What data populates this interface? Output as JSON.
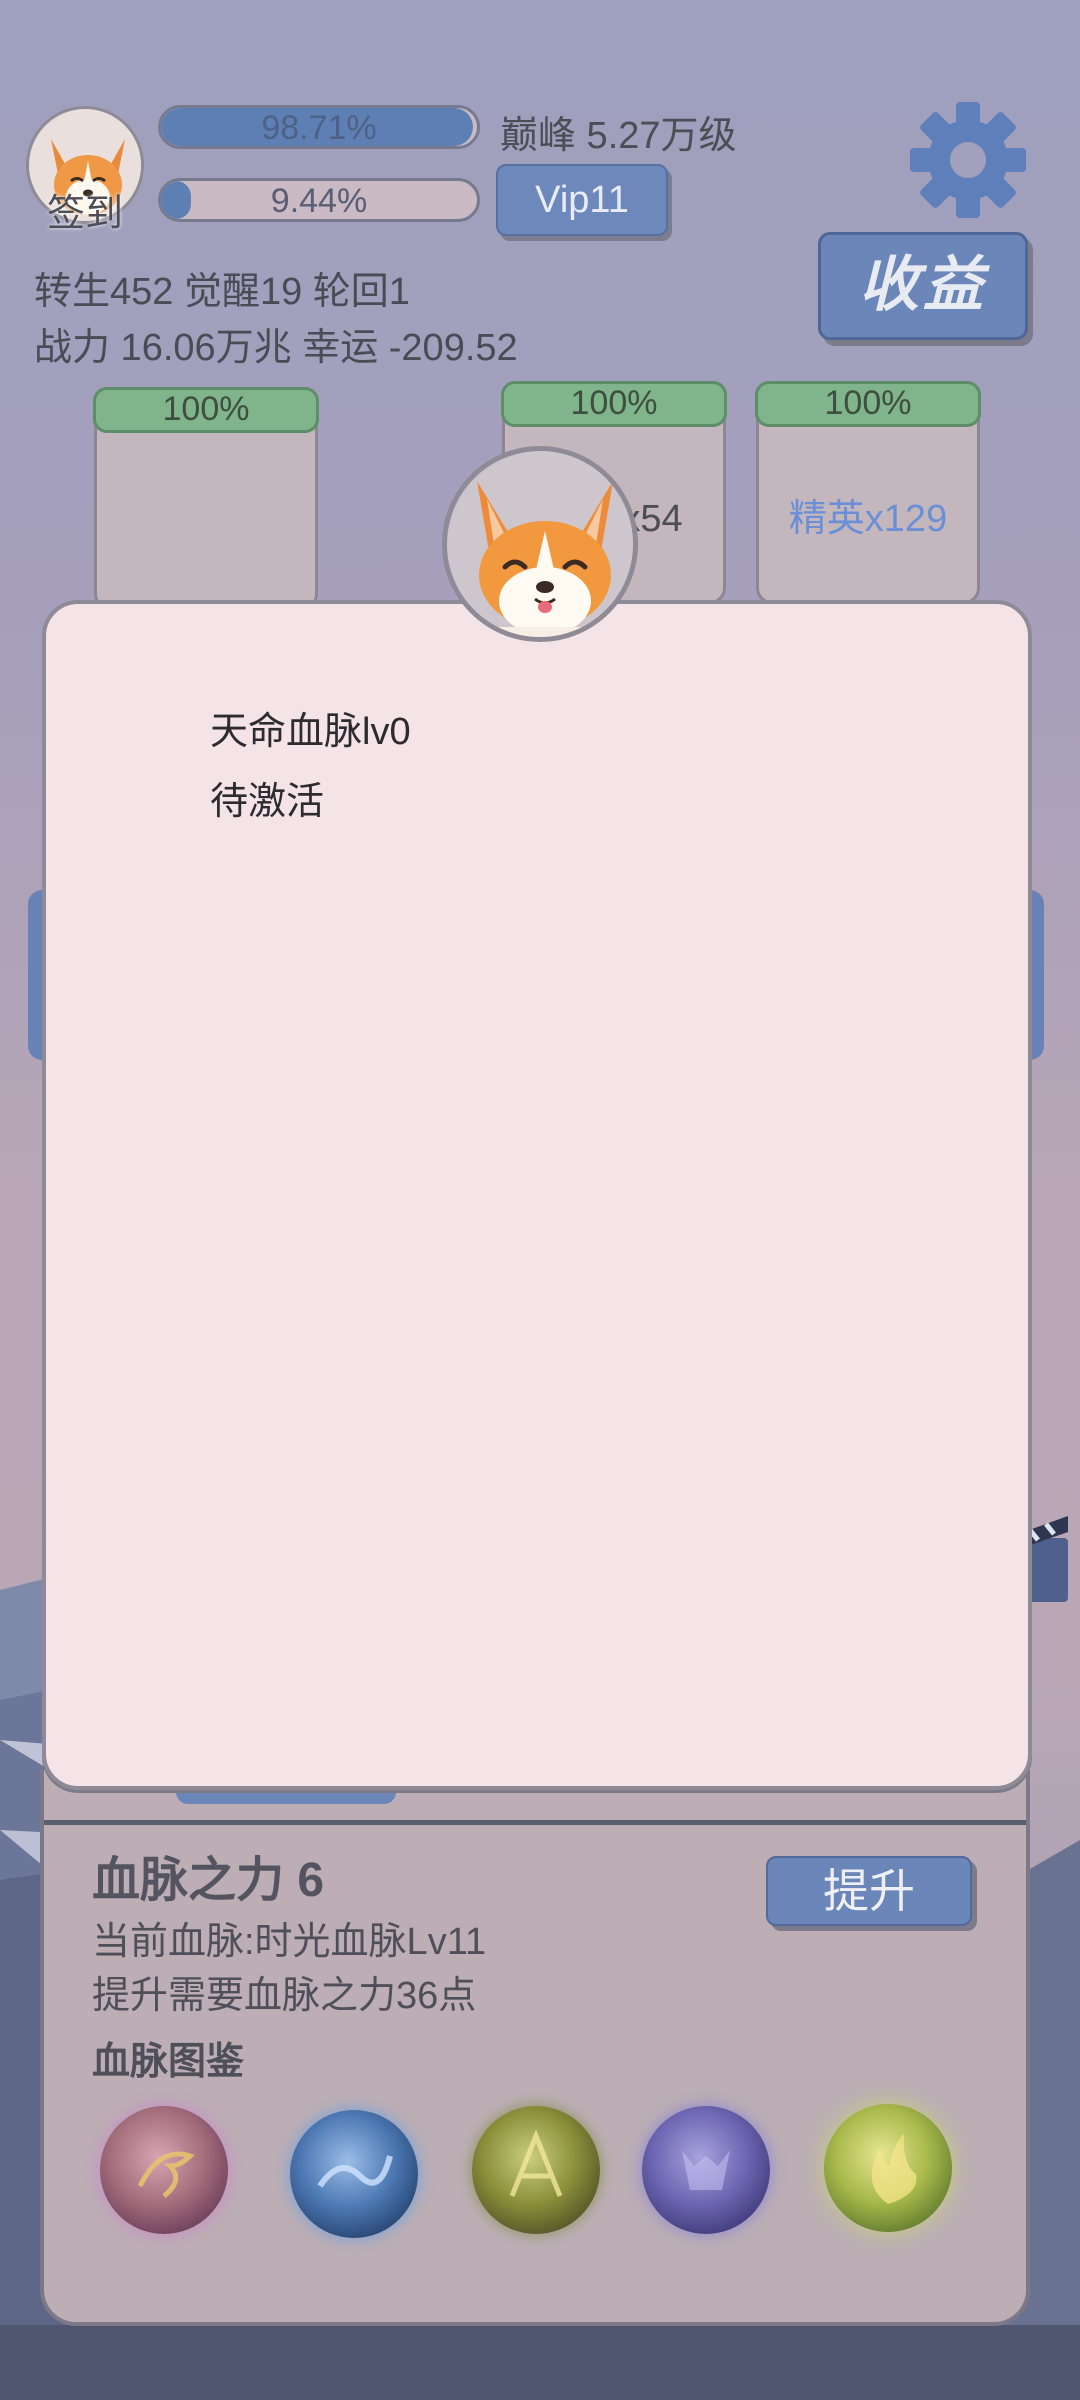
{
  "header": {
    "avatar_label": "签到",
    "exp_progress": {
      "percent": 98.71,
      "text": "98.71%"
    },
    "sub_progress": {
      "percent": 9.44,
      "text": "9.44%"
    },
    "peak_text": "巅峰 5.27万级",
    "vip_label": "Vip11",
    "income_label": "收益",
    "stats_line1": "转生452 觉醒19 轮回1",
    "stats_line2": "战力 16.06万兆  幸运 -209.52"
  },
  "cards": [
    {
      "percent": "100%",
      "label": ""
    },
    {
      "percent": "100%",
      "label": "小怪x54"
    },
    {
      "percent": "100%",
      "label": "精英x129"
    }
  ],
  "modal": {
    "line1": "天命血脉lv0",
    "line2": "待激活"
  },
  "bloodline_panel": {
    "title": "血脉之力 6",
    "current": "当前血脉:时光血脉Lv11",
    "requirement": "提升需要血脉之力36点",
    "album_label": "血脉图鉴",
    "upgrade_label": "提升",
    "orbs": [
      "dragon-orb-icon",
      "wave-orb-icon",
      "phoenix-orb-icon",
      "demon-orb-icon",
      "flame-orb-icon"
    ]
  },
  "colors": {
    "accent_blue": "#6b86b9",
    "progress_green": "#80b48a",
    "modal_bg": "#f5e4e7",
    "album_highlight": "#6b8fd6"
  }
}
